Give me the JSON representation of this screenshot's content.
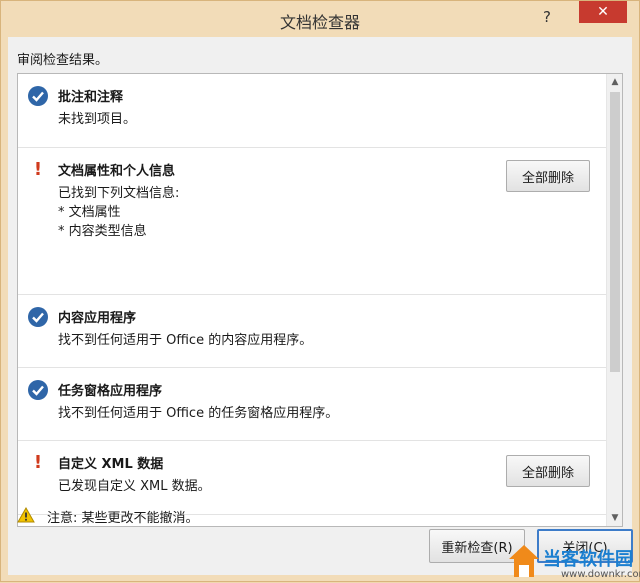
{
  "window": {
    "title": "文档检查器",
    "help_glyph": "?",
    "close_glyph": "✕"
  },
  "review_label": "审阅检查结果。",
  "items": [
    {
      "status": "ok",
      "icon": "checkmark-circle-icon",
      "title": "批注和注释",
      "lines": [
        "未找到项目。"
      ]
    },
    {
      "status": "warning",
      "icon": "exclamation-icon",
      "title": "文档属性和个人信息",
      "lines": [
        "已找到下列文档信息:",
        "* 文档属性",
        "* 内容类型信息"
      ],
      "button": "全部删除"
    },
    {
      "status": "ok",
      "icon": "checkmark-circle-icon",
      "title": "内容应用程序",
      "lines": [
        "找不到任何适用于 Office 的内容应用程序。"
      ]
    },
    {
      "status": "ok",
      "icon": "checkmark-circle-icon",
      "title": "任务窗格应用程序",
      "lines": [
        "找不到任何适用于 Office 的任务窗格应用程序。"
      ]
    },
    {
      "status": "warning",
      "icon": "exclamation-icon",
      "title": "自定义 XML 数据",
      "lines": [
        "已发现自定义 XML 数据。"
      ],
      "button": "全部删除"
    }
  ],
  "note": "注意: 某些更改不能撤消。",
  "buttons": {
    "reinspect": "重新检查(R)",
    "close": "关闭(C)"
  },
  "colors": {
    "ok_icon": "#2f66a8",
    "warning_icon": "#d03a1d",
    "close_button": "#c73a2f"
  },
  "watermark": {
    "name": "当客软件园",
    "url": "www.downkr.com"
  }
}
